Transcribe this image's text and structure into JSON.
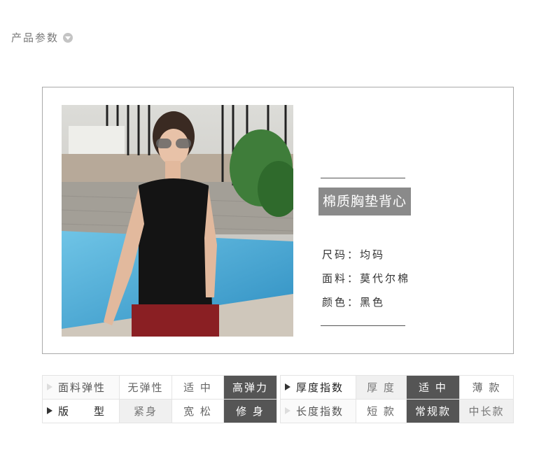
{
  "section": {
    "title": "产品参数"
  },
  "product": {
    "name": "棉质胸垫背心",
    "specs": [
      {
        "text": "尺码：均码"
      },
      {
        "text": "面料：莫代尔棉"
      },
      {
        "text": "颜色：黑色"
      }
    ]
  },
  "table_left": {
    "rows": [
      {
        "label": "面料弹性",
        "options": [
          "无弹性",
          "适 中",
          "高弹力"
        ],
        "selected": 2
      },
      {
        "label": "版　　型",
        "options": [
          "紧身",
          "宽 松",
          "修 身"
        ],
        "selected": 2
      }
    ]
  },
  "table_right": {
    "rows": [
      {
        "label": "厚度指数",
        "options": [
          "厚 度",
          "适 中",
          "薄 款"
        ],
        "selected": 1
      },
      {
        "label": "长度指数",
        "options": [
          "短 款",
          "常规款",
          "中长款"
        ],
        "selected": 1
      }
    ]
  },
  "colors": {
    "selected": "#555555",
    "label_bg": "#8a8a8a"
  }
}
